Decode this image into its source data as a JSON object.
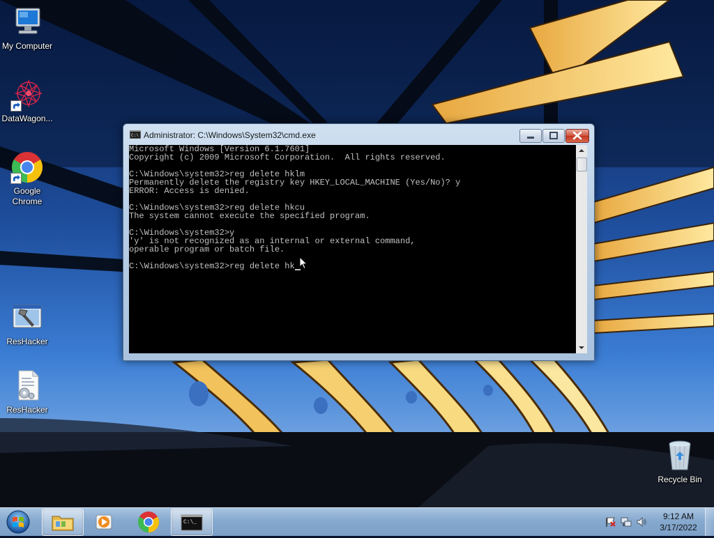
{
  "desktop": {
    "icons": [
      {
        "label": "My Computer",
        "icon": "computer-icon"
      },
      {
        "label": "DataWagon...",
        "icon": "datawagon-icon"
      },
      {
        "label": "Google Chrome",
        "icon": "chrome-icon"
      },
      {
        "label": "ResHacker",
        "icon": "reshacker-icon"
      },
      {
        "label": "ResHacker",
        "icon": "reshacker-file-icon"
      },
      {
        "label": "Recycle Bin",
        "icon": "recycle-bin-icon"
      }
    ]
  },
  "cmd_window": {
    "title": "Administrator: C:\\Windows\\System32\\cmd.exe",
    "lines": [
      "Microsoft Windows [Version 6.1.7601]",
      "Copyright (c) 2009 Microsoft Corporation.  All rights reserved.",
      "",
      "C:\\Windows\\system32>reg delete hklm",
      "Permanently delete the registry key HKEY_LOCAL_MACHINE (Yes/No)? y",
      "ERROR: Access is denied.",
      "",
      "C:\\Windows\\system32>reg delete hkcu",
      "The system cannot execute the specified program.",
      "",
      "C:\\Windows\\system32>y",
      "'y' is not recognized as an internal or external command,",
      "operable program or batch file.",
      "",
      "C:\\Windows\\system32>reg delete hk"
    ],
    "controls": {
      "minimize": "minimize-icon",
      "maximize": "maximize-icon",
      "close": "close-icon"
    }
  },
  "taskbar": {
    "start": "windows-start-icon",
    "pinned": [
      "explorer-icon",
      "media-player-icon",
      "chrome-icon",
      "cmd-icon"
    ],
    "tray": [
      "action-center-flag-icon",
      "network-icon",
      "volume-icon"
    ],
    "clock_time": "9:12 AM",
    "clock_date": "3/17/2022"
  },
  "colors": {
    "console_bg": "#000000",
    "console_fg": "#c0c0c0",
    "taskbar": "#86a9cf",
    "close_button": "#c3351f"
  }
}
